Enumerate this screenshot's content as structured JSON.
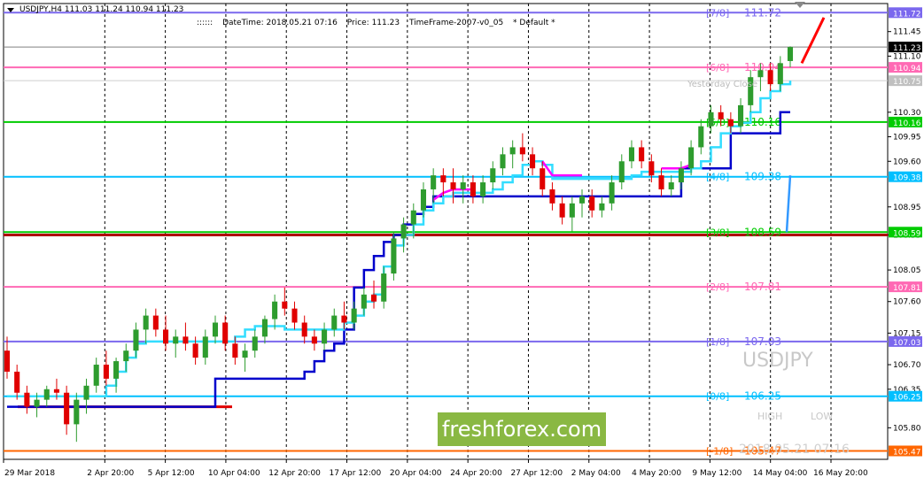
{
  "header": {
    "symbol_tf": "USDJPY,H4",
    "ohlc": "111.03 111.24 110.94 111.23",
    "info_prefix": "::::::",
    "datetime": "DateTime: 2018.05.21 07:16",
    "price": "Price: 111.23",
    "timeframe": "TimeFrame-2007-v0_05",
    "default": "*  Default  *"
  },
  "overlay": {
    "symbol": "USDJPY",
    "high_label": "HIGH",
    "low_label": "LOW",
    "timestamp": "2018.05.21 07:16",
    "watermark": "freshforex.com",
    "yesterday_close": "Yesterday Close"
  },
  "colors": {
    "bull": "#2e9c2e",
    "bear": "#e00000",
    "cyan_line": "#33ddff",
    "blue_line": "#0000cc",
    "magenta": "#ff00ff",
    "arrow": "#ff0000"
  },
  "chart_data": {
    "type": "line",
    "symbol": "USDJPY",
    "timeframe": "H4",
    "ylim": [
      105.35,
      111.85
    ],
    "y_tick_labels": [
      "111.45",
      "111.10",
      "110.30",
      "109.95",
      "109.60",
      "108.95",
      "108.55",
      "108.05",
      "107.60",
      "107.15",
      "106.70",
      "106.35",
      "105.80"
    ],
    "x_tick_labels": [
      "29 Mar 2018",
      "2 Apr 20:00",
      "5 Apr 12:00",
      "10 Apr 04:00",
      "12 Apr 20:00",
      "17 Apr 12:00",
      "20 Apr 04:00",
      "24 Apr 20:00",
      "27 Apr 12:00",
      "2 May 04:00",
      "4 May 20:00",
      "9 May 12:00",
      "14 May 04:00",
      "16 May 20:00"
    ],
    "current_price": {
      "label": "111.23",
      "value": 111.23
    },
    "yesterday_close": {
      "label": "110.75",
      "value": 110.75
    },
    "murrey_levels": [
      {
        "name": "[7/8]",
        "label": "111.72",
        "value": 111.72,
        "color": "#7b68ee"
      },
      {
        "name": "[6/8]",
        "label": "110.94",
        "value": 110.94,
        "color": "#ff69b4"
      },
      {
        "name": "[5/8]",
        "label": "110.16",
        "value": 110.16,
        "color": "#00cc00"
      },
      {
        "name": "[4/8]",
        "label": "109.38",
        "value": 109.38,
        "color": "#00bfff"
      },
      {
        "name": "[3/8]",
        "label": "108.59",
        "value": 108.59,
        "color": "#00cc00"
      },
      {
        "name": "[2/8]",
        "label": "107.81",
        "value": 107.81,
        "color": "#ff69b4"
      },
      {
        "name": "[1/8]",
        "label": "107.03",
        "value": 107.03,
        "color": "#7b68ee"
      },
      {
        "name": "[0/8]",
        "label": "106.25",
        "value": 106.25,
        "color": "#00bfff"
      },
      {
        "name": "[-1/8]",
        "label": "105.47",
        "value": 105.47,
        "color": "#ff6600"
      }
    ],
    "red_band": 108.55,
    "candles": [
      {
        "o": 106.9,
        "h": 107.1,
        "l": 106.5,
        "c": 106.6
      },
      {
        "o": 106.6,
        "h": 106.7,
        "l": 106.2,
        "c": 106.3
      },
      {
        "o": 106.3,
        "h": 106.4,
        "l": 106.0,
        "c": 106.1
      },
      {
        "o": 106.1,
        "h": 106.3,
        "l": 105.95,
        "c": 106.2
      },
      {
        "o": 106.2,
        "h": 106.4,
        "l": 106.1,
        "c": 106.35
      },
      {
        "o": 106.35,
        "h": 106.5,
        "l": 106.2,
        "c": 106.3
      },
      {
        "o": 106.3,
        "h": 106.4,
        "l": 105.7,
        "c": 105.85
      },
      {
        "o": 105.85,
        "h": 106.3,
        "l": 105.6,
        "c": 106.2
      },
      {
        "o": 106.2,
        "h": 106.5,
        "l": 106.0,
        "c": 106.4
      },
      {
        "o": 106.4,
        "h": 106.8,
        "l": 106.3,
        "c": 106.7
      },
      {
        "o": 106.7,
        "h": 106.9,
        "l": 106.4,
        "c": 106.5
      },
      {
        "o": 106.5,
        "h": 106.8,
        "l": 106.3,
        "c": 106.75
      },
      {
        "o": 106.75,
        "h": 107.0,
        "l": 106.6,
        "c": 106.9
      },
      {
        "o": 106.9,
        "h": 107.3,
        "l": 106.8,
        "c": 107.2
      },
      {
        "o": 107.2,
        "h": 107.5,
        "l": 107.0,
        "c": 107.4
      },
      {
        "o": 107.4,
        "h": 107.5,
        "l": 107.1,
        "c": 107.2
      },
      {
        "o": 107.2,
        "h": 107.4,
        "l": 106.9,
        "c": 107.0
      },
      {
        "o": 107.0,
        "h": 107.2,
        "l": 106.8,
        "c": 107.1
      },
      {
        "o": 107.1,
        "h": 107.3,
        "l": 106.9,
        "c": 107.0
      },
      {
        "o": 107.0,
        "h": 107.1,
        "l": 106.7,
        "c": 106.8
      },
      {
        "o": 106.8,
        "h": 107.2,
        "l": 106.7,
        "c": 107.1
      },
      {
        "o": 107.1,
        "h": 107.4,
        "l": 107.0,
        "c": 107.3
      },
      {
        "o": 107.3,
        "h": 107.4,
        "l": 106.9,
        "c": 107.0
      },
      {
        "o": 107.0,
        "h": 107.1,
        "l": 106.7,
        "c": 106.8
      },
      {
        "o": 106.8,
        "h": 107.0,
        "l": 106.6,
        "c": 106.9
      },
      {
        "o": 106.9,
        "h": 107.2,
        "l": 106.8,
        "c": 107.1
      },
      {
        "o": 107.1,
        "h": 107.4,
        "l": 107.0,
        "c": 107.35
      },
      {
        "o": 107.35,
        "h": 107.7,
        "l": 107.2,
        "c": 107.6
      },
      {
        "o": 107.6,
        "h": 107.8,
        "l": 107.4,
        "c": 107.5
      },
      {
        "o": 107.5,
        "h": 107.6,
        "l": 107.2,
        "c": 107.3
      },
      {
        "o": 107.3,
        "h": 107.4,
        "l": 107.0,
        "c": 107.1
      },
      {
        "o": 107.1,
        "h": 107.2,
        "l": 106.9,
        "c": 107.0
      },
      {
        "o": 107.0,
        "h": 107.3,
        "l": 106.9,
        "c": 107.2
      },
      {
        "o": 107.2,
        "h": 107.5,
        "l": 107.1,
        "c": 107.4
      },
      {
        "o": 107.4,
        "h": 107.6,
        "l": 107.2,
        "c": 107.3
      },
      {
        "o": 107.3,
        "h": 107.6,
        "l": 107.2,
        "c": 107.5
      },
      {
        "o": 107.5,
        "h": 107.8,
        "l": 107.4,
        "c": 107.7
      },
      {
        "o": 107.7,
        "h": 107.9,
        "l": 107.5,
        "c": 107.6
      },
      {
        "o": 107.6,
        "h": 108.1,
        "l": 107.5,
        "c": 108.0
      },
      {
        "o": 108.0,
        "h": 108.6,
        "l": 107.9,
        "c": 108.5
      },
      {
        "o": 108.5,
        "h": 108.8,
        "l": 108.3,
        "c": 108.7
      },
      {
        "o": 108.7,
        "h": 109.0,
        "l": 108.5,
        "c": 108.9
      },
      {
        "o": 108.9,
        "h": 109.3,
        "l": 108.8,
        "c": 109.2
      },
      {
        "o": 109.2,
        "h": 109.5,
        "l": 109.0,
        "c": 109.4
      },
      {
        "o": 109.4,
        "h": 109.5,
        "l": 109.1,
        "c": 109.3
      },
      {
        "o": 109.3,
        "h": 109.5,
        "l": 109.0,
        "c": 109.2
      },
      {
        "o": 109.2,
        "h": 109.4,
        "l": 109.0,
        "c": 109.3
      },
      {
        "o": 109.3,
        "h": 109.4,
        "l": 109.0,
        "c": 109.1
      },
      {
        "o": 109.1,
        "h": 109.4,
        "l": 109.0,
        "c": 109.3
      },
      {
        "o": 109.3,
        "h": 109.6,
        "l": 109.2,
        "c": 109.5
      },
      {
        "o": 109.5,
        "h": 109.8,
        "l": 109.4,
        "c": 109.7
      },
      {
        "o": 109.7,
        "h": 109.9,
        "l": 109.5,
        "c": 109.8
      },
      {
        "o": 109.8,
        "h": 110.0,
        "l": 109.6,
        "c": 109.7
      },
      {
        "o": 109.7,
        "h": 109.8,
        "l": 109.4,
        "c": 109.5
      },
      {
        "o": 109.5,
        "h": 109.6,
        "l": 109.1,
        "c": 109.2
      },
      {
        "o": 109.2,
        "h": 109.3,
        "l": 108.9,
        "c": 109.0
      },
      {
        "o": 109.0,
        "h": 109.1,
        "l": 108.7,
        "c": 108.8
      },
      {
        "o": 108.8,
        "h": 109.1,
        "l": 108.6,
        "c": 109.0
      },
      {
        "o": 109.0,
        "h": 109.2,
        "l": 108.8,
        "c": 109.1
      },
      {
        "o": 109.1,
        "h": 109.2,
        "l": 108.8,
        "c": 108.9
      },
      {
        "o": 108.9,
        "h": 109.1,
        "l": 108.8,
        "c": 109.0
      },
      {
        "o": 109.0,
        "h": 109.4,
        "l": 108.9,
        "c": 109.3
      },
      {
        "o": 109.3,
        "h": 109.7,
        "l": 109.2,
        "c": 109.6
      },
      {
        "o": 109.6,
        "h": 109.9,
        "l": 109.5,
        "c": 109.8
      },
      {
        "o": 109.8,
        "h": 109.9,
        "l": 109.5,
        "c": 109.6
      },
      {
        "o": 109.6,
        "h": 109.7,
        "l": 109.3,
        "c": 109.4
      },
      {
        "o": 109.4,
        "h": 109.5,
        "l": 109.1,
        "c": 109.2
      },
      {
        "o": 109.2,
        "h": 109.4,
        "l": 109.1,
        "c": 109.3
      },
      {
        "o": 109.3,
        "h": 109.6,
        "l": 109.2,
        "c": 109.5
      },
      {
        "o": 109.5,
        "h": 109.9,
        "l": 109.4,
        "c": 109.8
      },
      {
        "o": 109.8,
        "h": 110.2,
        "l": 109.7,
        "c": 110.1
      },
      {
        "o": 110.1,
        "h": 110.4,
        "l": 110.0,
        "c": 110.3
      },
      {
        "o": 110.3,
        "h": 110.4,
        "l": 110.1,
        "c": 110.2
      },
      {
        "o": 110.2,
        "h": 110.3,
        "l": 110.0,
        "c": 110.1
      },
      {
        "o": 110.1,
        "h": 110.5,
        "l": 110.0,
        "c": 110.4
      },
      {
        "o": 110.4,
        "h": 110.9,
        "l": 110.3,
        "c": 110.8
      },
      {
        "o": 110.8,
        "h": 111.0,
        "l": 110.6,
        "c": 110.9
      },
      {
        "o": 110.9,
        "h": 111.0,
        "l": 110.6,
        "c": 110.7
      },
      {
        "o": 110.7,
        "h": 111.1,
        "l": 110.6,
        "c": 111.0
      },
      {
        "o": 111.03,
        "h": 111.24,
        "l": 110.94,
        "c": 111.23
      }
    ],
    "cyan_series": [
      106.25,
      106.25,
      106.25,
      106.25,
      106.25,
      106.25,
      106.25,
      106.25,
      106.25,
      106.25,
      106.4,
      106.6,
      106.8,
      107.0,
      107.03,
      107.03,
      107.03,
      107.03,
      107.03,
      107.03,
      107.03,
      107.03,
      107.03,
      107.1,
      107.2,
      107.25,
      107.25,
      107.25,
      107.2,
      107.2,
      107.2,
      107.2,
      107.2,
      107.2,
      107.3,
      107.4,
      107.6,
      107.7,
      108.1,
      108.4,
      108.55,
      108.7,
      108.9,
      109.0,
      109.1,
      109.15,
      109.15,
      109.15,
      109.15,
      109.2,
      109.3,
      109.4,
      109.55,
      109.6,
      109.55,
      109.35,
      109.35,
      109.35,
      109.35,
      109.35,
      109.35,
      109.35,
      109.35,
      109.4,
      109.45,
      109.45,
      109.45,
      109.45,
      109.45,
      109.5,
      109.6,
      109.8,
      110.0,
      110.1,
      110.15,
      110.3,
      110.5,
      110.6,
      110.7,
      110.75
    ],
    "blue_series": [
      106.1,
      106.1,
      106.1,
      106.1,
      106.1,
      106.1,
      106.1,
      106.1,
      106.1,
      106.1,
      106.1,
      106.1,
      106.1,
      106.1,
      106.1,
      106.1,
      106.1,
      106.1,
      106.1,
      106.1,
      106.1,
      106.5,
      106.5,
      106.5,
      106.5,
      106.5,
      106.5,
      106.5,
      106.5,
      106.5,
      106.6,
      106.75,
      106.9,
      107.0,
      107.2,
      107.8,
      108.05,
      108.25,
      108.45,
      108.55,
      108.7,
      108.85,
      108.95,
      109.1,
      109.1,
      109.1,
      109.1,
      109.1,
      109.1,
      109.1,
      109.1,
      109.1,
      109.1,
      109.1,
      109.1,
      109.1,
      109.1,
      109.1,
      109.1,
      109.1,
      109.1,
      109.1,
      109.1,
      109.1,
      109.1,
      109.1,
      109.1,
      109.1,
      109.5,
      109.5,
      109.5,
      109.5,
      109.5,
      110.0,
      110.0,
      110.0,
      110.0,
      110.0,
      110.3,
      110.3
    ],
    "blue_extension": [
      108.59,
      109.4
    ],
    "arrow": {
      "from": 111.0,
      "to": 111.65
    }
  }
}
